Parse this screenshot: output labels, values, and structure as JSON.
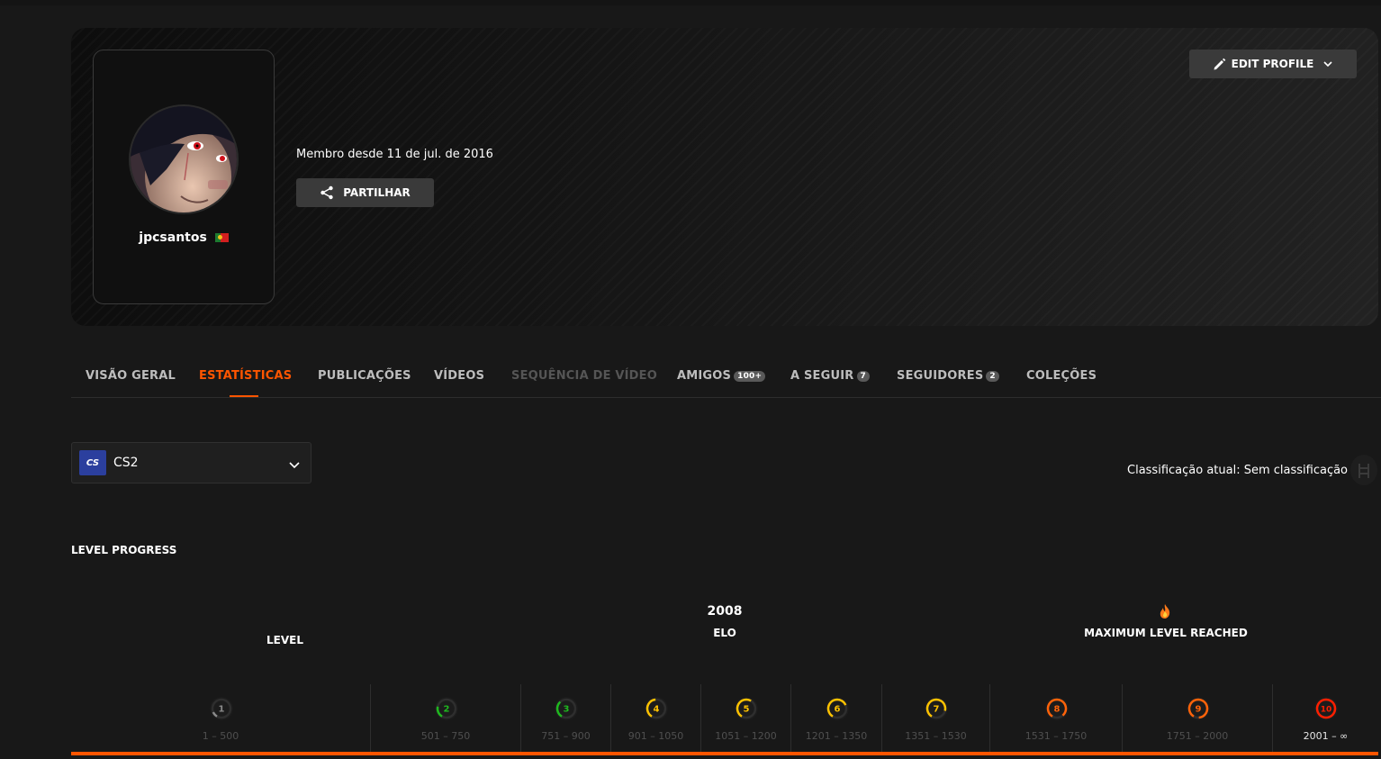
{
  "profile": {
    "username": "jpcsantos",
    "country_flag": "Portugal",
    "member_since": "Membro desde 11 de jul. de 2016",
    "share_label": "PARTILHAR",
    "edit_label": "EDIT PROFILE"
  },
  "tabs": [
    {
      "label": "VISÃO GERAL",
      "state": "normal"
    },
    {
      "label": "ESTATÍSTICAS",
      "state": "active"
    },
    {
      "label": "PUBLICAÇÕES",
      "state": "normal"
    },
    {
      "label": "VÍDEOS",
      "state": "normal"
    },
    {
      "label": "SEQUÊNCIA DE VÍDEO",
      "state": "disabled"
    },
    {
      "label": "AMIGOS",
      "badge": "100+",
      "state": "normal"
    },
    {
      "label": "A SEGUIR",
      "badge": "7",
      "state": "normal"
    },
    {
      "label": "SEGUIDORES",
      "badge": "2",
      "state": "normal"
    },
    {
      "label": "COLEÇÕES",
      "state": "normal"
    }
  ],
  "game_selector": {
    "logo_text": "CS",
    "selected": "CS2"
  },
  "classification": "Classificação atual: Sem classificação",
  "level_progress": {
    "title": "LEVEL PROGRESS",
    "level_label": "LEVEL",
    "elo_value": "2008",
    "elo_label": "ELO",
    "max_label": "MAXIMUM LEVEL REACHED",
    "progress_fraction": 1.0,
    "levels": [
      {
        "level": "1",
        "range": "1 – 500",
        "color": "#8a8a8a"
      },
      {
        "level": "2",
        "range": "501 – 750",
        "color": "#1fb81f"
      },
      {
        "level": "3",
        "range": "751 – 900",
        "color": "#1fb81f"
      },
      {
        "level": "4",
        "range": "901 – 1050",
        "color": "#ffc200"
      },
      {
        "level": "5",
        "range": "1051 – 1200",
        "color": "#ffc200"
      },
      {
        "level": "6",
        "range": "1201 – 1350",
        "color": "#ffc200"
      },
      {
        "level": "7",
        "range": "1351 – 1530",
        "color": "#ffc200"
      },
      {
        "level": "8",
        "range": "1531 – 1750",
        "color": "#ff6309"
      },
      {
        "level": "9",
        "range": "1751 – 2000",
        "color": "#ff6309"
      },
      {
        "level": "10",
        "range": "2001 – ∞",
        "color": "#fe1f00",
        "current": true
      }
    ]
  }
}
